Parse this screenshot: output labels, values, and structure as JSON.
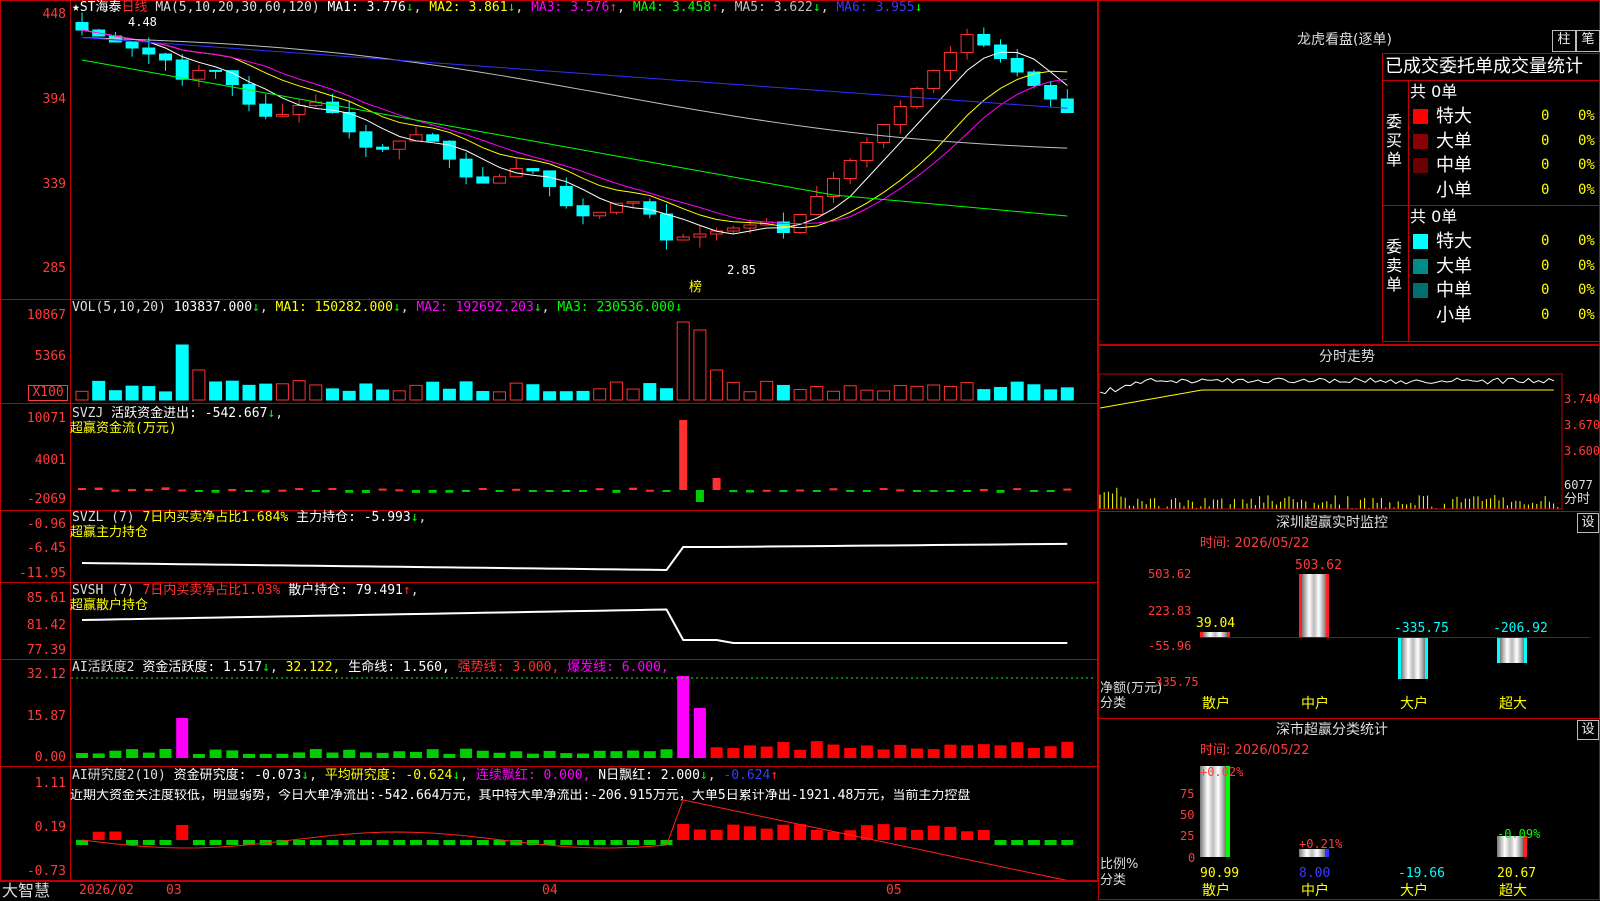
{
  "kline": {
    "stock_name": "★ST海泰",
    "period": "日线",
    "ma_header": "MA(5,10,20,30,60,120)",
    "ma": [
      {
        "label": "MA1:",
        "value": "3.776",
        "arrow": "↓",
        "color": "#ffffff"
      },
      {
        "label": "MA2:",
        "value": "3.861",
        "arrow": "↓",
        "color": "#ffff00"
      },
      {
        "label": "MA3:",
        "value": "3.576",
        "arrow": "↑",
        "color": "#ff00ff"
      },
      {
        "label": "MA4:",
        "value": "3.458",
        "arrow": "↑",
        "color": "#00ff00"
      },
      {
        "label": "MA5:",
        "value": "3.622",
        "arrow": "↓",
        "color": "#c0c0c0"
      },
      {
        "label": "MA6:",
        "value": "3.955",
        "arrow": "↓",
        "color": "#3030ff"
      }
    ],
    "axis": [
      "448",
      "394",
      "339",
      "285"
    ],
    "high_label": "4.48",
    "low_label": "2.85",
    "bang_label": "榜"
  },
  "vol": {
    "header": "VOL(5,10,20)",
    "value": "103837.000",
    "ma": [
      {
        "label": "MA1:",
        "value": "150282.000",
        "color": "#ffff00"
      },
      {
        "label": "MA2:",
        "value": "192692.203",
        "color": "#ff00ff"
      },
      {
        "label": "MA3:",
        "value": "230536.000",
        "color": "#00ff00"
      }
    ],
    "axis": [
      "10867",
      "5366",
      "X100"
    ]
  },
  "svzj": {
    "title": "SVZJ",
    "desc": "活跃资金进出:",
    "value": "-542.667",
    "sub": "超赢资金流(万元)",
    "axis": [
      "10071",
      "4001",
      "-2069"
    ]
  },
  "svzl": {
    "title": "SVZL (7)",
    "desc": "7日内买卖净占比1.684%",
    "desc2": "主力持仓:",
    "value": "-5.993",
    "sub": "超赢主力持仓",
    "axis": [
      "-0.96",
      "-6.45",
      "-11.95"
    ]
  },
  "svsh": {
    "title": "SVSH (7)",
    "desc": "7日内买卖净占比1.03%",
    "desc2": "散户持仓:",
    "value": "79.491",
    "sub": "超赢散户持仓",
    "axis": [
      "85.61",
      "81.42",
      "77.39"
    ]
  },
  "ai1": {
    "title": "AI活跃度2",
    "desc": "资金活跃度:",
    "value": "1.517",
    "v2": "32.122,",
    "life_label": "生命线:",
    "life_value": "1.560,",
    "strong_label": "强势线:",
    "strong_value": "3.000,",
    "burst_label": "爆发线:",
    "burst_value": "6.000,",
    "axis": [
      "32.12",
      "15.87",
      "0.00"
    ]
  },
  "ai2": {
    "title": "AI研究度2(10)",
    "desc": "资金研究度:",
    "value": "-0.073",
    "avg_label": "平均研究度:",
    "avg_value": "-0.624",
    "cont_label": "连续飘红:",
    "cont_value": "0.000,",
    "nday_label": "N日飘红:",
    "nday_value": "2.000",
    "last_value": "-0.624",
    "comment": "近期大资金关注度较低，明显弱势，今日大单净流出:-542.664万元，其中特大单净流出:-206.915万元，大单5日累计净出-1921.48万元，当前主力控盘",
    "axis": [
      "1.11",
      "0.19",
      "-0.73"
    ]
  },
  "dates": {
    "brand": "大智慧",
    "d0": "2026/02",
    "d1": "03",
    "d2": "04",
    "d3": "05"
  },
  "lhb": {
    "title": "龙虎看盘(逐单)",
    "tab1": "柱",
    "tab2": "笔",
    "header": "已成交委托单成交量统计",
    "buy": {
      "total": "共 0单",
      "side": "委买单",
      "rows": [
        {
          "name": "特大",
          "count": "0",
          "pct": "0%",
          "color": "#ff0000"
        },
        {
          "name": "大单",
          "count": "0",
          "pct": "0%",
          "color": "#8b0000"
        },
        {
          "name": "中单",
          "count": "0",
          "pct": "0%",
          "color": "#6b0000"
        },
        {
          "name": "小单",
          "count": "0",
          "pct": "0%",
          "color": "#000000"
        }
      ]
    },
    "sell": {
      "total": "共 0单",
      "side": "委卖单",
      "rows": [
        {
          "name": "特大",
          "count": "0",
          "pct": "0%",
          "color": "#00ffff"
        },
        {
          "name": "大单",
          "count": "0",
          "pct": "0%",
          "color": "#008b8b"
        },
        {
          "name": "中单",
          "count": "0",
          "pct": "0%",
          "color": "#006f6f"
        },
        {
          "name": "小单",
          "count": "0",
          "pct": "0%",
          "color": "#000000"
        }
      ]
    }
  },
  "fenshi": {
    "title": "分时走势",
    "axis": [
      "3.740",
      "3.670",
      "3.600",
      "6077"
    ],
    "unit": "分时"
  },
  "sz_monitor": {
    "title": "深圳超赢实时监控",
    "setting": "设",
    "time": "时间: 2026/05/22",
    "axis": [
      "503.62",
      "223.83",
      "-55.96",
      "-335.75"
    ],
    "unit1": "净额(万元)",
    "unit2": "分类",
    "categories": [
      "散户",
      "中户",
      "大户",
      "超大"
    ],
    "values": [
      "39.04",
      "503.62",
      "-335.75",
      "-206.92"
    ]
  },
  "sz_stats": {
    "title": "深市超赢分类统计",
    "setting": "设",
    "time": "时间: 2026/05/22",
    "axis": [
      "75",
      "50",
      "25",
      "0"
    ],
    "unit1": "比例%",
    "unit2": "分类",
    "categories": [
      "散户",
      "中户",
      "大户",
      "超大"
    ],
    "top_values": [
      "+0.02%",
      "+0.21%",
      "-0.09%"
    ],
    "bottom_values": [
      "90.99",
      "8.00",
      "-19.66",
      "20.67"
    ]
  }
}
